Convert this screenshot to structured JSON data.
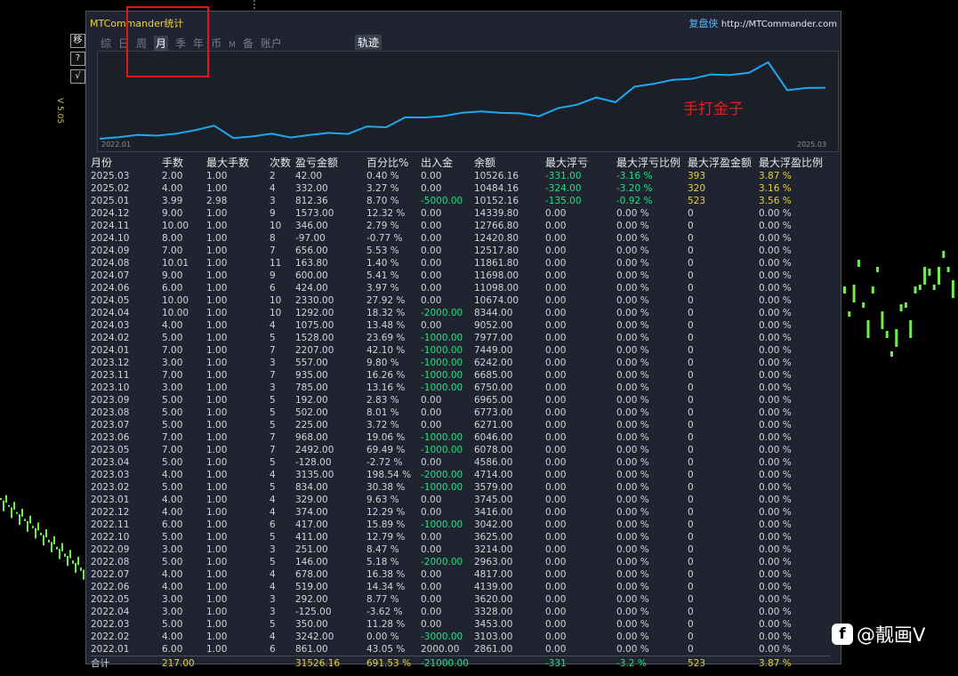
{
  "window": {
    "title": "MTCommander统计",
    "brand": "复盘侠",
    "url": "http://MTCommander.com",
    "version": "V 5.05",
    "side_buttons": [
      "移",
      "?",
      "√"
    ]
  },
  "tabs": [
    {
      "label": "综",
      "active": false
    },
    {
      "label": "日",
      "active": false
    },
    {
      "label": "周",
      "active": false
    },
    {
      "label": "月",
      "active": true
    },
    {
      "label": "季",
      "active": false
    },
    {
      "label": "年",
      "active": false
    },
    {
      "label": "币",
      "active": false
    },
    {
      "label": "M",
      "active": false
    },
    {
      "label": "备",
      "active": false
    },
    {
      "label": "账户",
      "active": false
    }
  ],
  "track_button": "轨迹",
  "annotation": "手打金子",
  "chart_data": {
    "type": "line",
    "x_start_label": "2022.01",
    "x_end_label": "2025.03",
    "x": [
      "2022.01",
      "2022.02",
      "2022.03",
      "2022.04",
      "2022.05",
      "2022.06",
      "2022.07",
      "2022.08",
      "2022.09",
      "2022.10",
      "2022.11",
      "2022.12",
      "2023.01",
      "2023.02",
      "2023.03",
      "2023.04",
      "2023.05",
      "2023.06",
      "2023.07",
      "2023.08",
      "2023.09",
      "2023.10",
      "2023.11",
      "2023.12",
      "2024.01",
      "2024.02",
      "2024.03",
      "2024.04",
      "2024.05",
      "2024.06",
      "2024.07",
      "2024.08",
      "2024.09",
      "2024.10",
      "2024.11",
      "2024.12",
      "2025.01",
      "2025.02",
      "2025.03"
    ],
    "series": [
      {
        "values": [
          2861,
          3103,
          3453,
          3328,
          3620,
          4139,
          4817,
          2963,
          3214,
          3625,
          3042,
          3416,
          3745,
          3579,
          4714,
          4586,
          6078,
          6046,
          6271,
          6773,
          6965,
          6750,
          6685,
          6242,
          7449,
          7977,
          9052,
          8344,
          10674,
          11098,
          11698,
          11861.8,
          12517.8,
          12420.8,
          12766.8,
          14339.8,
          10152.16,
          10484.16,
          10526.16
        ],
        "color": "#1ea8f0"
      }
    ]
  },
  "table": {
    "headers": [
      "月份",
      "手数",
      "最大手数",
      "次数",
      "盈亏金额",
      "百分比%",
      "出入金",
      "余额",
      "最大浮亏",
      "最大浮亏比例",
      "最大浮盈金额",
      "最大浮盈比例"
    ],
    "rows": [
      [
        "2025.03",
        "2.00",
        "1.00",
        "2",
        "42.00",
        "0.40 %",
        "0.00",
        "10526.16",
        "-331.00",
        "-3.16 %",
        "393",
        "3.87 %"
      ],
      [
        "2025.02",
        "4.00",
        "1.00",
        "4",
        "332.00",
        "3.27 %",
        "0.00",
        "10484.16",
        "-324.00",
        "-3.20 %",
        "320",
        "3.16 %"
      ],
      [
        "2025.01",
        "3.99",
        "2.98",
        "3",
        "812.36",
        "8.70 %",
        "-5000.00",
        "10152.16",
        "-135.00",
        "-0.92 %",
        "523",
        "3.56 %"
      ],
      [
        "2024.12",
        "9.00",
        "1.00",
        "9",
        "1573.00",
        "12.32 %",
        "0.00",
        "14339.80",
        "0.00",
        "0.00 %",
        "0",
        "0.00 %"
      ],
      [
        "2024.11",
        "10.00",
        "1.00",
        "10",
        "346.00",
        "2.79 %",
        "0.00",
        "12766.80",
        "0.00",
        "0.00 %",
        "0",
        "0.00 %"
      ],
      [
        "2024.10",
        "8.00",
        "1.00",
        "8",
        "-97.00",
        "-0.77 %",
        "0.00",
        "12420.80",
        "0.00",
        "0.00 %",
        "0",
        "0.00 %"
      ],
      [
        "2024.09",
        "7.00",
        "1.00",
        "7",
        "656.00",
        "5.53 %",
        "0.00",
        "12517.80",
        "0.00",
        "0.00 %",
        "0",
        "0.00 %"
      ],
      [
        "2024.08",
        "10.01",
        "1.00",
        "11",
        "163.80",
        "1.40 %",
        "0.00",
        "11861.80",
        "0.00",
        "0.00 %",
        "0",
        "0.00 %"
      ],
      [
        "2024.07",
        "9.00",
        "1.00",
        "9",
        "600.00",
        "5.41 %",
        "0.00",
        "11698.00",
        "0.00",
        "0.00 %",
        "0",
        "0.00 %"
      ],
      [
        "2024.06",
        "6.00",
        "1.00",
        "6",
        "424.00",
        "3.97 %",
        "0.00",
        "11098.00",
        "0.00",
        "0.00 %",
        "0",
        "0.00 %"
      ],
      [
        "2024.05",
        "10.00",
        "1.00",
        "10",
        "2330.00",
        "27.92 %",
        "0.00",
        "10674.00",
        "0.00",
        "0.00 %",
        "0",
        "0.00 %"
      ],
      [
        "2024.04",
        "10.00",
        "1.00",
        "10",
        "1292.00",
        "18.32 %",
        "-2000.00",
        "8344.00",
        "0.00",
        "0.00 %",
        "0",
        "0.00 %"
      ],
      [
        "2024.03",
        "4.00",
        "1.00",
        "4",
        "1075.00",
        "13.48 %",
        "0.00",
        "9052.00",
        "0.00",
        "0.00 %",
        "0",
        "0.00 %"
      ],
      [
        "2024.02",
        "5.00",
        "1.00",
        "5",
        "1528.00",
        "23.69 %",
        "-1000.00",
        "7977.00",
        "0.00",
        "0.00 %",
        "0",
        "0.00 %"
      ],
      [
        "2024.01",
        "7.00",
        "1.00",
        "7",
        "2207.00",
        "42.10 %",
        "-1000.00",
        "7449.00",
        "0.00",
        "0.00 %",
        "0",
        "0.00 %"
      ],
      [
        "2023.12",
        "3.00",
        "1.00",
        "3",
        "557.00",
        "9.80 %",
        "-1000.00",
        "6242.00",
        "0.00",
        "0.00 %",
        "0",
        "0.00 %"
      ],
      [
        "2023.11",
        "7.00",
        "1.00",
        "7",
        "935.00",
        "16.26 %",
        "-1000.00",
        "6685.00",
        "0.00",
        "0.00 %",
        "0",
        "0.00 %"
      ],
      [
        "2023.10",
        "3.00",
        "1.00",
        "3",
        "785.00",
        "13.16 %",
        "-1000.00",
        "6750.00",
        "0.00",
        "0.00 %",
        "0",
        "0.00 %"
      ],
      [
        "2023.09",
        "5.00",
        "1.00",
        "5",
        "192.00",
        "2.83 %",
        "0.00",
        "6965.00",
        "0.00",
        "0.00 %",
        "0",
        "0.00 %"
      ],
      [
        "2023.08",
        "5.00",
        "1.00",
        "5",
        "502.00",
        "8.01 %",
        "0.00",
        "6773.00",
        "0.00",
        "0.00 %",
        "0",
        "0.00 %"
      ],
      [
        "2023.07",
        "5.00",
        "1.00",
        "5",
        "225.00",
        "3.72 %",
        "0.00",
        "6271.00",
        "0.00",
        "0.00 %",
        "0",
        "0.00 %"
      ],
      [
        "2023.06",
        "7.00",
        "1.00",
        "7",
        "968.00",
        "19.06 %",
        "-1000.00",
        "6046.00",
        "0.00",
        "0.00 %",
        "0",
        "0.00 %"
      ],
      [
        "2023.05",
        "7.00",
        "1.00",
        "7",
        "2492.00",
        "69.49 %",
        "-1000.00",
        "6078.00",
        "0.00",
        "0.00 %",
        "0",
        "0.00 %"
      ],
      [
        "2023.04",
        "5.00",
        "1.00",
        "5",
        "-128.00",
        "-2.72 %",
        "0.00",
        "4586.00",
        "0.00",
        "0.00 %",
        "0",
        "0.00 %"
      ],
      [
        "2023.03",
        "4.00",
        "1.00",
        "4",
        "3135.00",
        "198.54 %",
        "-2000.00",
        "4714.00",
        "0.00",
        "0.00 %",
        "0",
        "0.00 %"
      ],
      [
        "2023.02",
        "5.00",
        "1.00",
        "5",
        "834.00",
        "30.38 %",
        "-1000.00",
        "3579.00",
        "0.00",
        "0.00 %",
        "0",
        "0.00 %"
      ],
      [
        "2023.01",
        "4.00",
        "1.00",
        "4",
        "329.00",
        "9.63 %",
        "0.00",
        "3745.00",
        "0.00",
        "0.00 %",
        "0",
        "0.00 %"
      ],
      [
        "2022.12",
        "4.00",
        "1.00",
        "4",
        "374.00",
        "12.29 %",
        "0.00",
        "3416.00",
        "0.00",
        "0.00 %",
        "0",
        "0.00 %"
      ],
      [
        "2022.11",
        "6.00",
        "1.00",
        "6",
        "417.00",
        "15.89 %",
        "-1000.00",
        "3042.00",
        "0.00",
        "0.00 %",
        "0",
        "0.00 %"
      ],
      [
        "2022.10",
        "5.00",
        "1.00",
        "5",
        "411.00",
        "12.79 %",
        "0.00",
        "3625.00",
        "0.00",
        "0.00 %",
        "0",
        "0.00 %"
      ],
      [
        "2022.09",
        "3.00",
        "1.00",
        "3",
        "251.00",
        "8.47 %",
        "0.00",
        "3214.00",
        "0.00",
        "0.00 %",
        "0",
        "0.00 %"
      ],
      [
        "2022.08",
        "5.00",
        "1.00",
        "5",
        "146.00",
        "5.18 %",
        "-2000.00",
        "2963.00",
        "0.00",
        "0.00 %",
        "0",
        "0.00 %"
      ],
      [
        "2022.07",
        "4.00",
        "1.00",
        "4",
        "678.00",
        "16.38 %",
        "0.00",
        "4817.00",
        "0.00",
        "0.00 %",
        "0",
        "0.00 %"
      ],
      [
        "2022.06",
        "4.00",
        "1.00",
        "4",
        "519.00",
        "14.34 %",
        "0.00",
        "4139.00",
        "0.00",
        "0.00 %",
        "0",
        "0.00 %"
      ],
      [
        "2022.05",
        "3.00",
        "1.00",
        "3",
        "292.00",
        "8.77 %",
        "0.00",
        "3620.00",
        "0.00",
        "0.00 %",
        "0",
        "0.00 %"
      ],
      [
        "2022.04",
        "3.00",
        "1.00",
        "3",
        "-125.00",
        "-3.62 %",
        "0.00",
        "3328.00",
        "0.00",
        "0.00 %",
        "0",
        "0.00 %"
      ],
      [
        "2022.03",
        "5.00",
        "1.00",
        "5",
        "350.00",
        "11.28 %",
        "0.00",
        "3453.00",
        "0.00",
        "0.00 %",
        "0",
        "0.00 %"
      ],
      [
        "2022.02",
        "4.00",
        "1.00",
        "4",
        "3242.00",
        "0.00 %",
        "-3000.00",
        "3103.00",
        "0.00",
        "0.00 %",
        "0",
        "0.00 %"
      ],
      [
        "2022.01",
        "6.00",
        "1.00",
        "6",
        "861.00",
        "43.05 %",
        "2000.00",
        "2861.00",
        "0.00",
        "0.00 %",
        "0",
        "0.00 %"
      ]
    ],
    "total": [
      "合计",
      "217.00",
      "",
      "",
      "31526.16",
      "691.53 %",
      "-21000.00",
      "",
      "-331",
      "-3.2 %",
      "523",
      "3.87 %"
    ]
  },
  "watermark": "@靓画V",
  "colors": {
    "accent_line": "#1ea8f0",
    "positive": "#e8d040",
    "negative": "#22e082",
    "candle_up": "#6ef04a",
    "highlight_box": "#e01818"
  }
}
